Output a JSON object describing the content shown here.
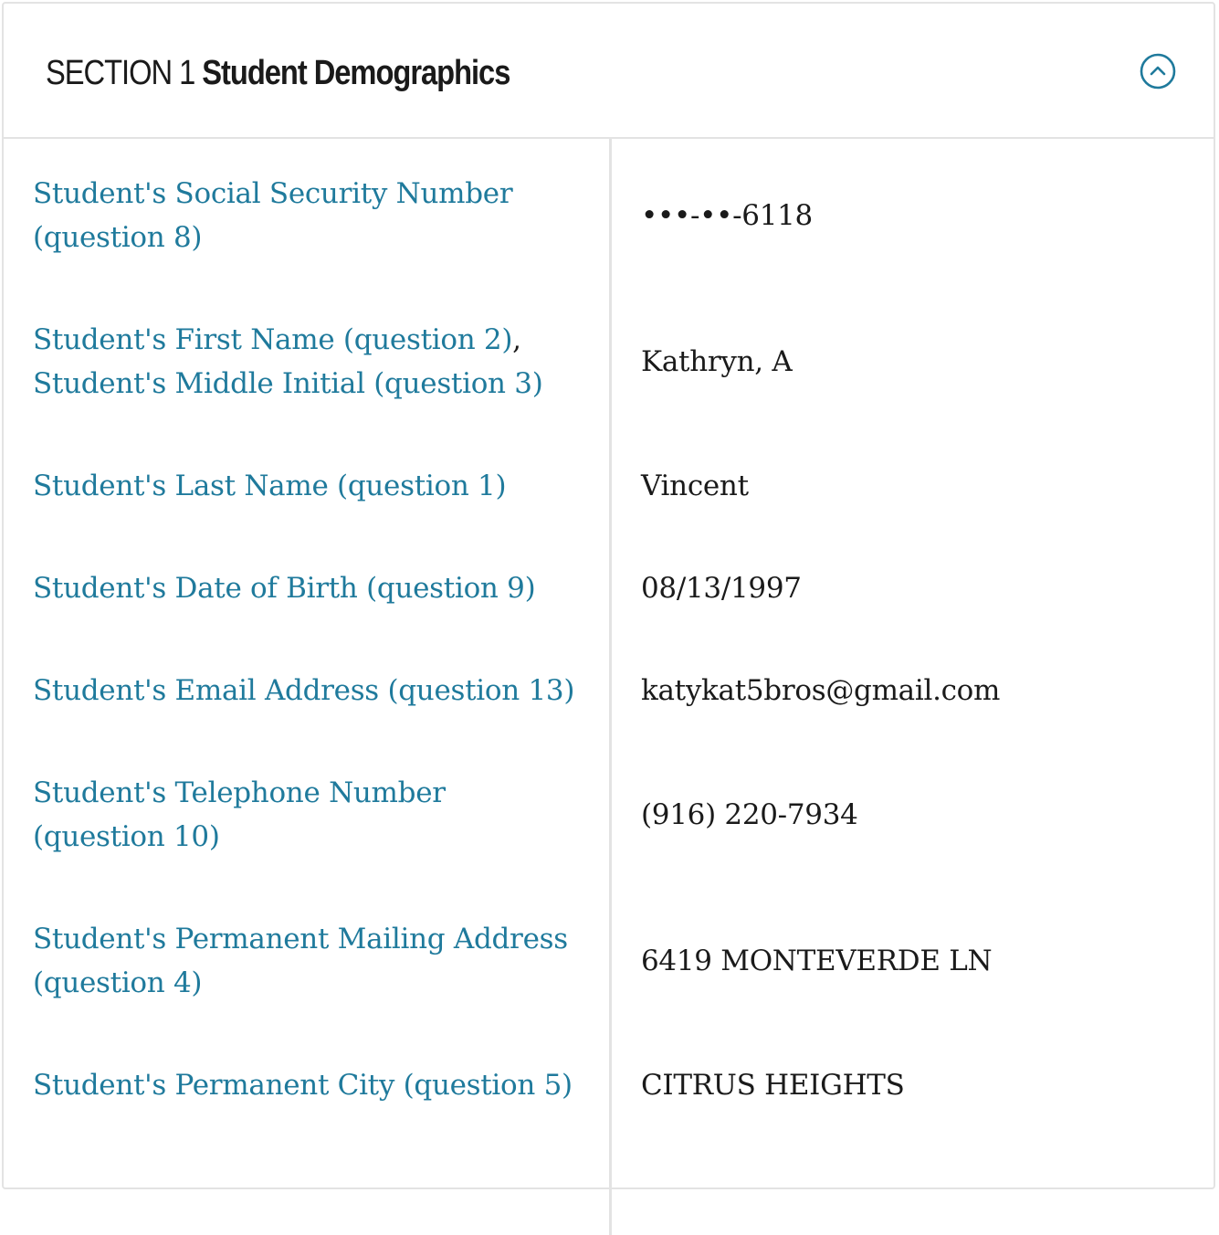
{
  "section": {
    "number_label": "SECTION 1",
    "title": "Student Demographics",
    "toggle_icon": "chevron-up-circle-icon",
    "accent_color": "#1f7a9c"
  },
  "rows": [
    {
      "labels": [
        "Student's Social Security Number (question 8)"
      ],
      "value": "•••-••-6118"
    },
    {
      "labels": [
        "Student's First Name (question 2)",
        "Student's Middle Initial (question 3)"
      ],
      "separator": ",",
      "value": "Kathryn, A"
    },
    {
      "labels": [
        "Student's Last Name (question 1)"
      ],
      "value": "Vincent"
    },
    {
      "labels": [
        "Student's Date of Birth (question 9)"
      ],
      "value": "08/13/1997"
    },
    {
      "labels": [
        "Student's Email Address (question 13)"
      ],
      "value": "katykat5bros@gmail.com"
    },
    {
      "labels": [
        "Student's Telephone Number (question 10)"
      ],
      "value": "(916) 220-7934"
    },
    {
      "labels": [
        "Student's Permanent Mailing Address (question 4)"
      ],
      "value": "6419 MONTEVERDE LN"
    },
    {
      "labels": [
        "Student's Permanent City (question 5)"
      ],
      "value": "CITRUS HEIGHTS"
    }
  ]
}
